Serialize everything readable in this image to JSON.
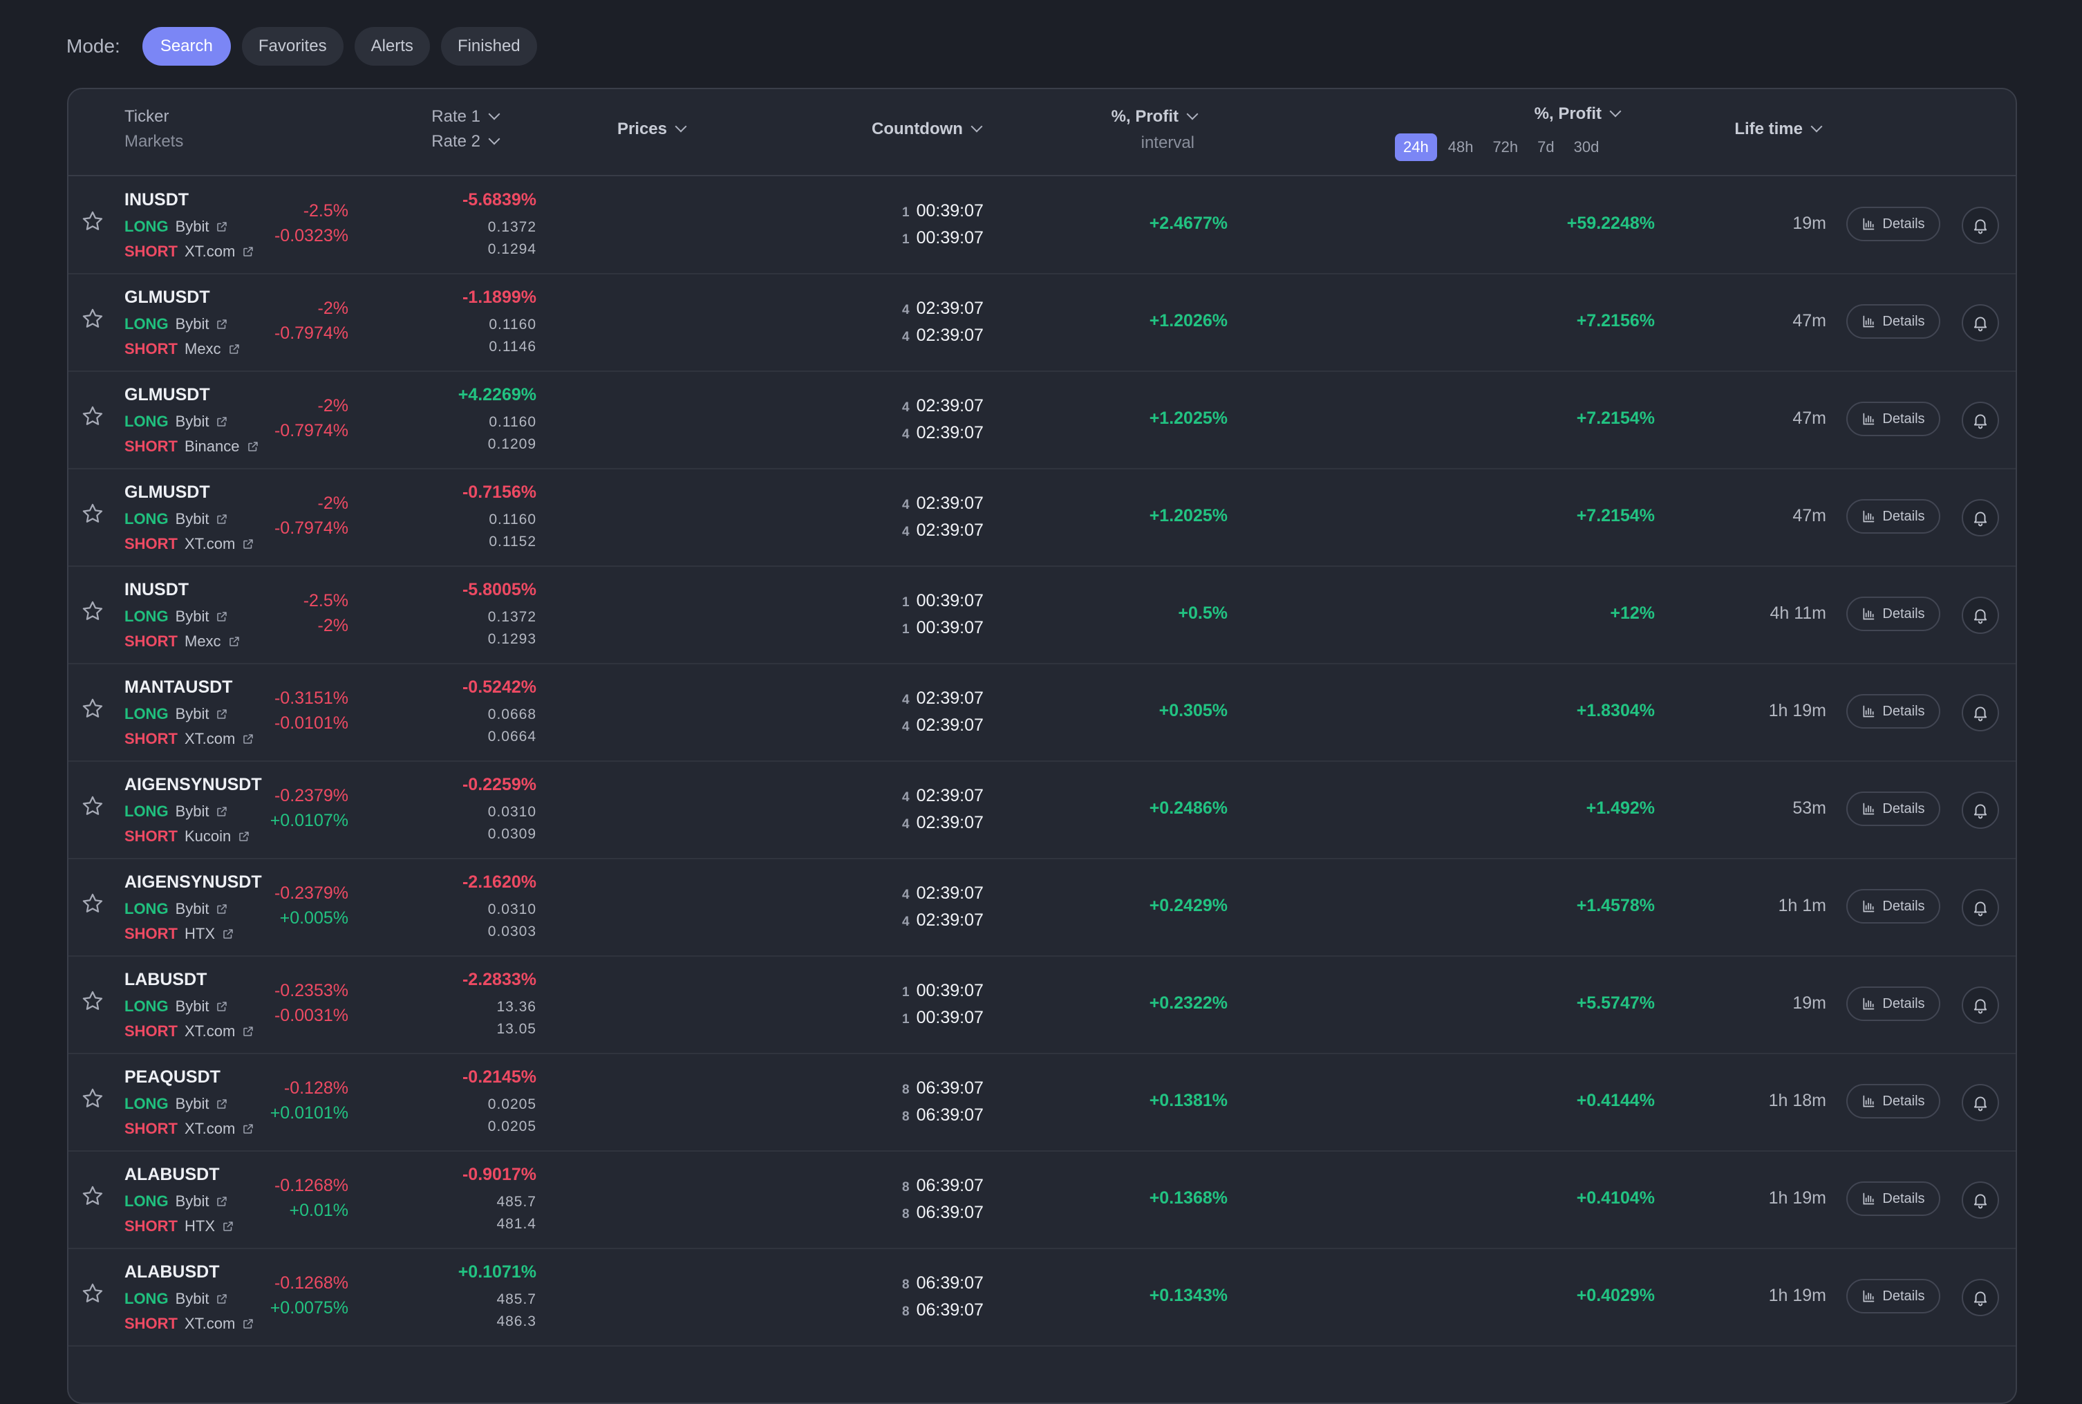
{
  "mode": {
    "label": "Mode:",
    "options": [
      "Search",
      "Favorites",
      "Alerts",
      "Finished"
    ],
    "active": "Search"
  },
  "header": {
    "ticker": "Ticker",
    "markets": "Markets",
    "rate1": "Rate 1",
    "rate2": "Rate 2",
    "prices": "Prices",
    "countdown": "Countdown",
    "profit_interval": "%, Profit",
    "interval": "interval",
    "profit_total": "%, Profit",
    "intervals": [
      "24h",
      "48h",
      "72h",
      "7d",
      "30d"
    ],
    "active_interval": "24h",
    "lifetime": "Life time"
  },
  "details_label": "Details",
  "colors": {
    "accent": "#7b86f5",
    "positive": "#22c382",
    "negative": "#ee4a63"
  },
  "rows": [
    {
      "ticker": "INUSDT",
      "long": "Bybit",
      "short": "XT.com",
      "rate1": "-2.5%",
      "rate2": "-0.0323%",
      "price_diff": "-5.6839%",
      "price1": "0.1372",
      "price2": "0.1294",
      "cd1_n": "1",
      "cd1": "00:39:07",
      "cd2_n": "1",
      "cd2": "00:39:07",
      "profit_interval": "+2.4677%",
      "profit_total": "+59.2248%",
      "lifetime": "19m"
    },
    {
      "ticker": "GLMUSDT",
      "long": "Bybit",
      "short": "Mexc",
      "rate1": "-2%",
      "rate2": "-0.7974%",
      "price_diff": "-1.1899%",
      "price1": "0.1160",
      "price2": "0.1146",
      "cd1_n": "4",
      "cd1": "02:39:07",
      "cd2_n": "4",
      "cd2": "02:39:07",
      "profit_interval": "+1.2026%",
      "profit_total": "+7.2156%",
      "lifetime": "47m"
    },
    {
      "ticker": "GLMUSDT",
      "long": "Bybit",
      "short": "Binance",
      "rate1": "-2%",
      "rate2": "-0.7974%",
      "price_diff": "+4.2269%",
      "price1": "0.1160",
      "price2": "0.1209",
      "cd1_n": "4",
      "cd1": "02:39:07",
      "cd2_n": "4",
      "cd2": "02:39:07",
      "profit_interval": "+1.2025%",
      "profit_total": "+7.2154%",
      "lifetime": "47m"
    },
    {
      "ticker": "GLMUSDT",
      "long": "Bybit",
      "short": "XT.com",
      "rate1": "-2%",
      "rate2": "-0.7974%",
      "price_diff": "-0.7156%",
      "price1": "0.1160",
      "price2": "0.1152",
      "cd1_n": "4",
      "cd1": "02:39:07",
      "cd2_n": "4",
      "cd2": "02:39:07",
      "profit_interval": "+1.2025%",
      "profit_total": "+7.2154%",
      "lifetime": "47m"
    },
    {
      "ticker": "INUSDT",
      "long": "Bybit",
      "short": "Mexc",
      "rate1": "-2.5%",
      "rate2": "-2%",
      "price_diff": "-5.8005%",
      "price1": "0.1372",
      "price2": "0.1293",
      "cd1_n": "1",
      "cd1": "00:39:07",
      "cd2_n": "1",
      "cd2": "00:39:07",
      "profit_interval": "+0.5%",
      "profit_total": "+12%",
      "lifetime": "4h 11m"
    },
    {
      "ticker": "MANTAUSDT",
      "long": "Bybit",
      "short": "XT.com",
      "rate1": "-0.3151%",
      "rate2": "-0.0101%",
      "price_diff": "-0.5242%",
      "price1": "0.0668",
      "price2": "0.0664",
      "cd1_n": "4",
      "cd1": "02:39:07",
      "cd2_n": "4",
      "cd2": "02:39:07",
      "profit_interval": "+0.305%",
      "profit_total": "+1.8304%",
      "lifetime": "1h 19m"
    },
    {
      "ticker": "AIGENSYNUSDT",
      "long": "Bybit",
      "short": "Kucoin",
      "rate1": "-0.2379%",
      "rate2": "+0.0107%",
      "price_diff": "-0.2259%",
      "price1": "0.0310",
      "price2": "0.0309",
      "cd1_n": "4",
      "cd1": "02:39:07",
      "cd2_n": "4",
      "cd2": "02:39:07",
      "profit_interval": "+0.2486%",
      "profit_total": "+1.492%",
      "lifetime": "53m"
    },
    {
      "ticker": "AIGENSYNUSDT",
      "long": "Bybit",
      "short": "HTX",
      "rate1": "-0.2379%",
      "rate2": "+0.005%",
      "price_diff": "-2.1620%",
      "price1": "0.0310",
      "price2": "0.0303",
      "cd1_n": "4",
      "cd1": "02:39:07",
      "cd2_n": "4",
      "cd2": "02:39:07",
      "profit_interval": "+0.2429%",
      "profit_total": "+1.4578%",
      "lifetime": "1h 1m"
    },
    {
      "ticker": "LABUSDT",
      "long": "Bybit",
      "short": "XT.com",
      "rate1": "-0.2353%",
      "rate2": "-0.0031%",
      "price_diff": "-2.2833%",
      "price1": "13.36",
      "price2": "13.05",
      "cd1_n": "1",
      "cd1": "00:39:07",
      "cd2_n": "1",
      "cd2": "00:39:07",
      "profit_interval": "+0.2322%",
      "profit_total": "+5.5747%",
      "lifetime": "19m"
    },
    {
      "ticker": "PEAQUSDT",
      "long": "Bybit",
      "short": "XT.com",
      "rate1": "-0.128%",
      "rate2": "+0.0101%",
      "price_diff": "-0.2145%",
      "price1": "0.0205",
      "price2": "0.0205",
      "cd1_n": "8",
      "cd1": "06:39:07",
      "cd2_n": "8",
      "cd2": "06:39:07",
      "profit_interval": "+0.1381%",
      "profit_total": "+0.4144%",
      "lifetime": "1h 18m"
    },
    {
      "ticker": "ALABUSDT",
      "long": "Bybit",
      "short": "HTX",
      "rate1": "-0.1268%",
      "rate2": "+0.01%",
      "price_diff": "-0.9017%",
      "price1": "485.7",
      "price2": "481.4",
      "cd1_n": "8",
      "cd1": "06:39:07",
      "cd2_n": "8",
      "cd2": "06:39:07",
      "profit_interval": "+0.1368%",
      "profit_total": "+0.4104%",
      "lifetime": "1h 19m"
    },
    {
      "ticker": "ALABUSDT",
      "long": "Bybit",
      "short": "XT.com",
      "rate1": "-0.1268%",
      "rate2": "+0.0075%",
      "price_diff": "+0.1071%",
      "price1": "485.7",
      "price2": "486.3",
      "cd1_n": "8",
      "cd1": "06:39:07",
      "cd2_n": "8",
      "cd2": "06:39:07",
      "profit_interval": "+0.1343%",
      "profit_total": "+0.4029%",
      "lifetime": "1h 19m"
    }
  ]
}
